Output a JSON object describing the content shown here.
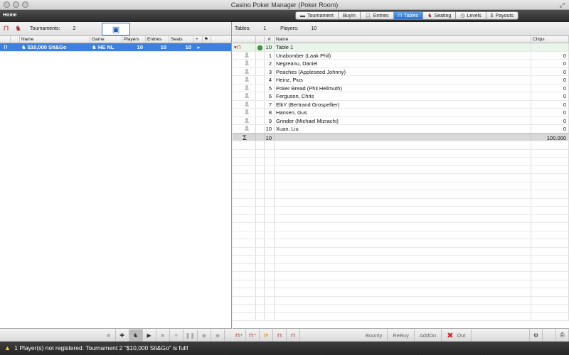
{
  "window": {
    "title": "Casino Poker Manager (Poker Room)"
  },
  "toolbar": {
    "home_label": "Home",
    "tabs": [
      {
        "label": "Tournament",
        "icon": "tournament-icon",
        "selected": false
      },
      {
        "label": "BuyIn",
        "icon": "",
        "selected": false
      },
      {
        "label": "Entries",
        "icon": "person-icon",
        "selected": false
      },
      {
        "label": "Tables",
        "icon": "table-icon",
        "selected": true
      },
      {
        "label": "Seating",
        "icon": "chair-icon",
        "selected": false
      },
      {
        "label": "Levels",
        "icon": "clock-icon",
        "selected": false
      },
      {
        "label": "Payouts",
        "icon": "dollar-icon",
        "selected": false
      }
    ]
  },
  "left": {
    "tournaments_label": "Tournaments:",
    "tournaments_count": "2",
    "columns": [
      "Name",
      "Game",
      "Players",
      "Entries",
      "Seats"
    ],
    "rows": [
      {
        "name": "$10,000 Sit&Go",
        "game": "HE NL",
        "players": "10",
        "entries": "10",
        "seats": "10",
        "selected": true
      }
    ]
  },
  "right": {
    "tables_label": "Tables:",
    "tables_count": "1",
    "players_label": "Players:",
    "players_count": "10",
    "columns": [
      "#",
      "Name",
      "Chips"
    ],
    "table_row": {
      "num": "10",
      "name": "Table 1"
    },
    "players": [
      {
        "num": "1",
        "name": "Unabomber (Laak Phil)",
        "chips": "0"
      },
      {
        "num": "2",
        "name": "Negreanu, Daniel",
        "chips": "0"
      },
      {
        "num": "3",
        "name": "Peaches (Appleseed Johnny)",
        "chips": "0"
      },
      {
        "num": "4",
        "name": "Heinz, Pius",
        "chips": "0"
      },
      {
        "num": "5",
        "name": "Poker Bread (Phil Hellmuth)",
        "chips": "0"
      },
      {
        "num": "6",
        "name": "Ferguson, Chris",
        "chips": "0"
      },
      {
        "num": "7",
        "name": "ElkY (Bertrand Grospellier)",
        "chips": "0"
      },
      {
        "num": "8",
        "name": "Hansen, Gus",
        "chips": "0"
      },
      {
        "num": "9",
        "name": "Grinder (Michael Mizrachi)",
        "chips": "0"
      },
      {
        "num": "10",
        "name": "Xuan, Liu",
        "chips": "0"
      }
    ],
    "sum_symbol": "Σ",
    "sum_count": "10",
    "sum_chips": "100.000"
  },
  "bottom_right": {
    "bounty": "Bounty",
    "rebuy": "ReBuy",
    "addon": "AddOn",
    "out": "Out"
  },
  "status": {
    "message": "1 Player(s) not registered. Tournament 2 \"$10,000 Sit&Go\" is full!"
  }
}
